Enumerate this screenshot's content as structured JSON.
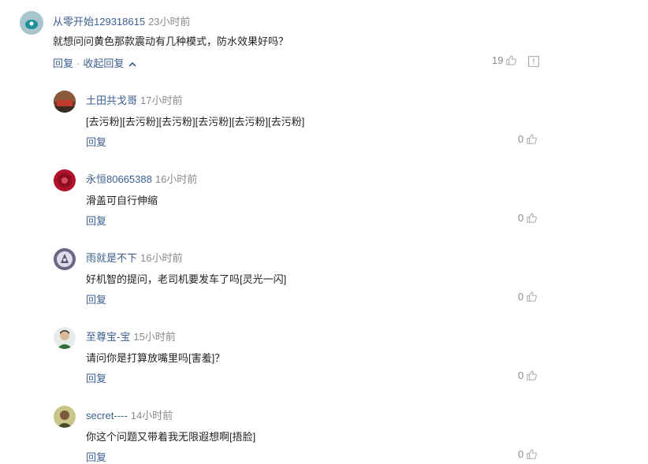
{
  "main": {
    "user": "从零开始129318615",
    "time": "23小时前",
    "text": "就想问问黄色那款震动有几种模式，防水效果好吗？",
    "reply_label": "回复",
    "separator": "·",
    "collapse_label": "收起回复",
    "likes": "19"
  },
  "replies": [
    {
      "user": "土田共戈哥",
      "time": "17小时前",
      "text": "[去污粉][去污粉][去污粉][去污粉][去污粉][去污粉]",
      "reply_label": "回复",
      "likes": "0"
    },
    {
      "user": "永恒80665388",
      "time": "16小时前",
      "text": "滑盖可自行伸缩",
      "reply_label": "回复",
      "likes": "0"
    },
    {
      "user": "雨就是不下",
      "time": "16小时前",
      "text": "好机智的提问，老司机要发车了吗[灵光一闪]",
      "reply_label": "回复",
      "likes": "0"
    },
    {
      "user": "至尊宝-宝",
      "time": "15小时前",
      "text": "请问你是打算放嘴里吗[害羞]？",
      "reply_label": "回复",
      "likes": "0"
    },
    {
      "user": "secret----",
      "time": "14小时前",
      "text": "你这个问题又带着我无限遐想啊[捂脸]",
      "reply_label": "回复",
      "likes": "0"
    }
  ],
  "colors": {
    "username": "#3a5f8f",
    "time": "#8a8a8a",
    "icon": "#b0b0b0"
  }
}
